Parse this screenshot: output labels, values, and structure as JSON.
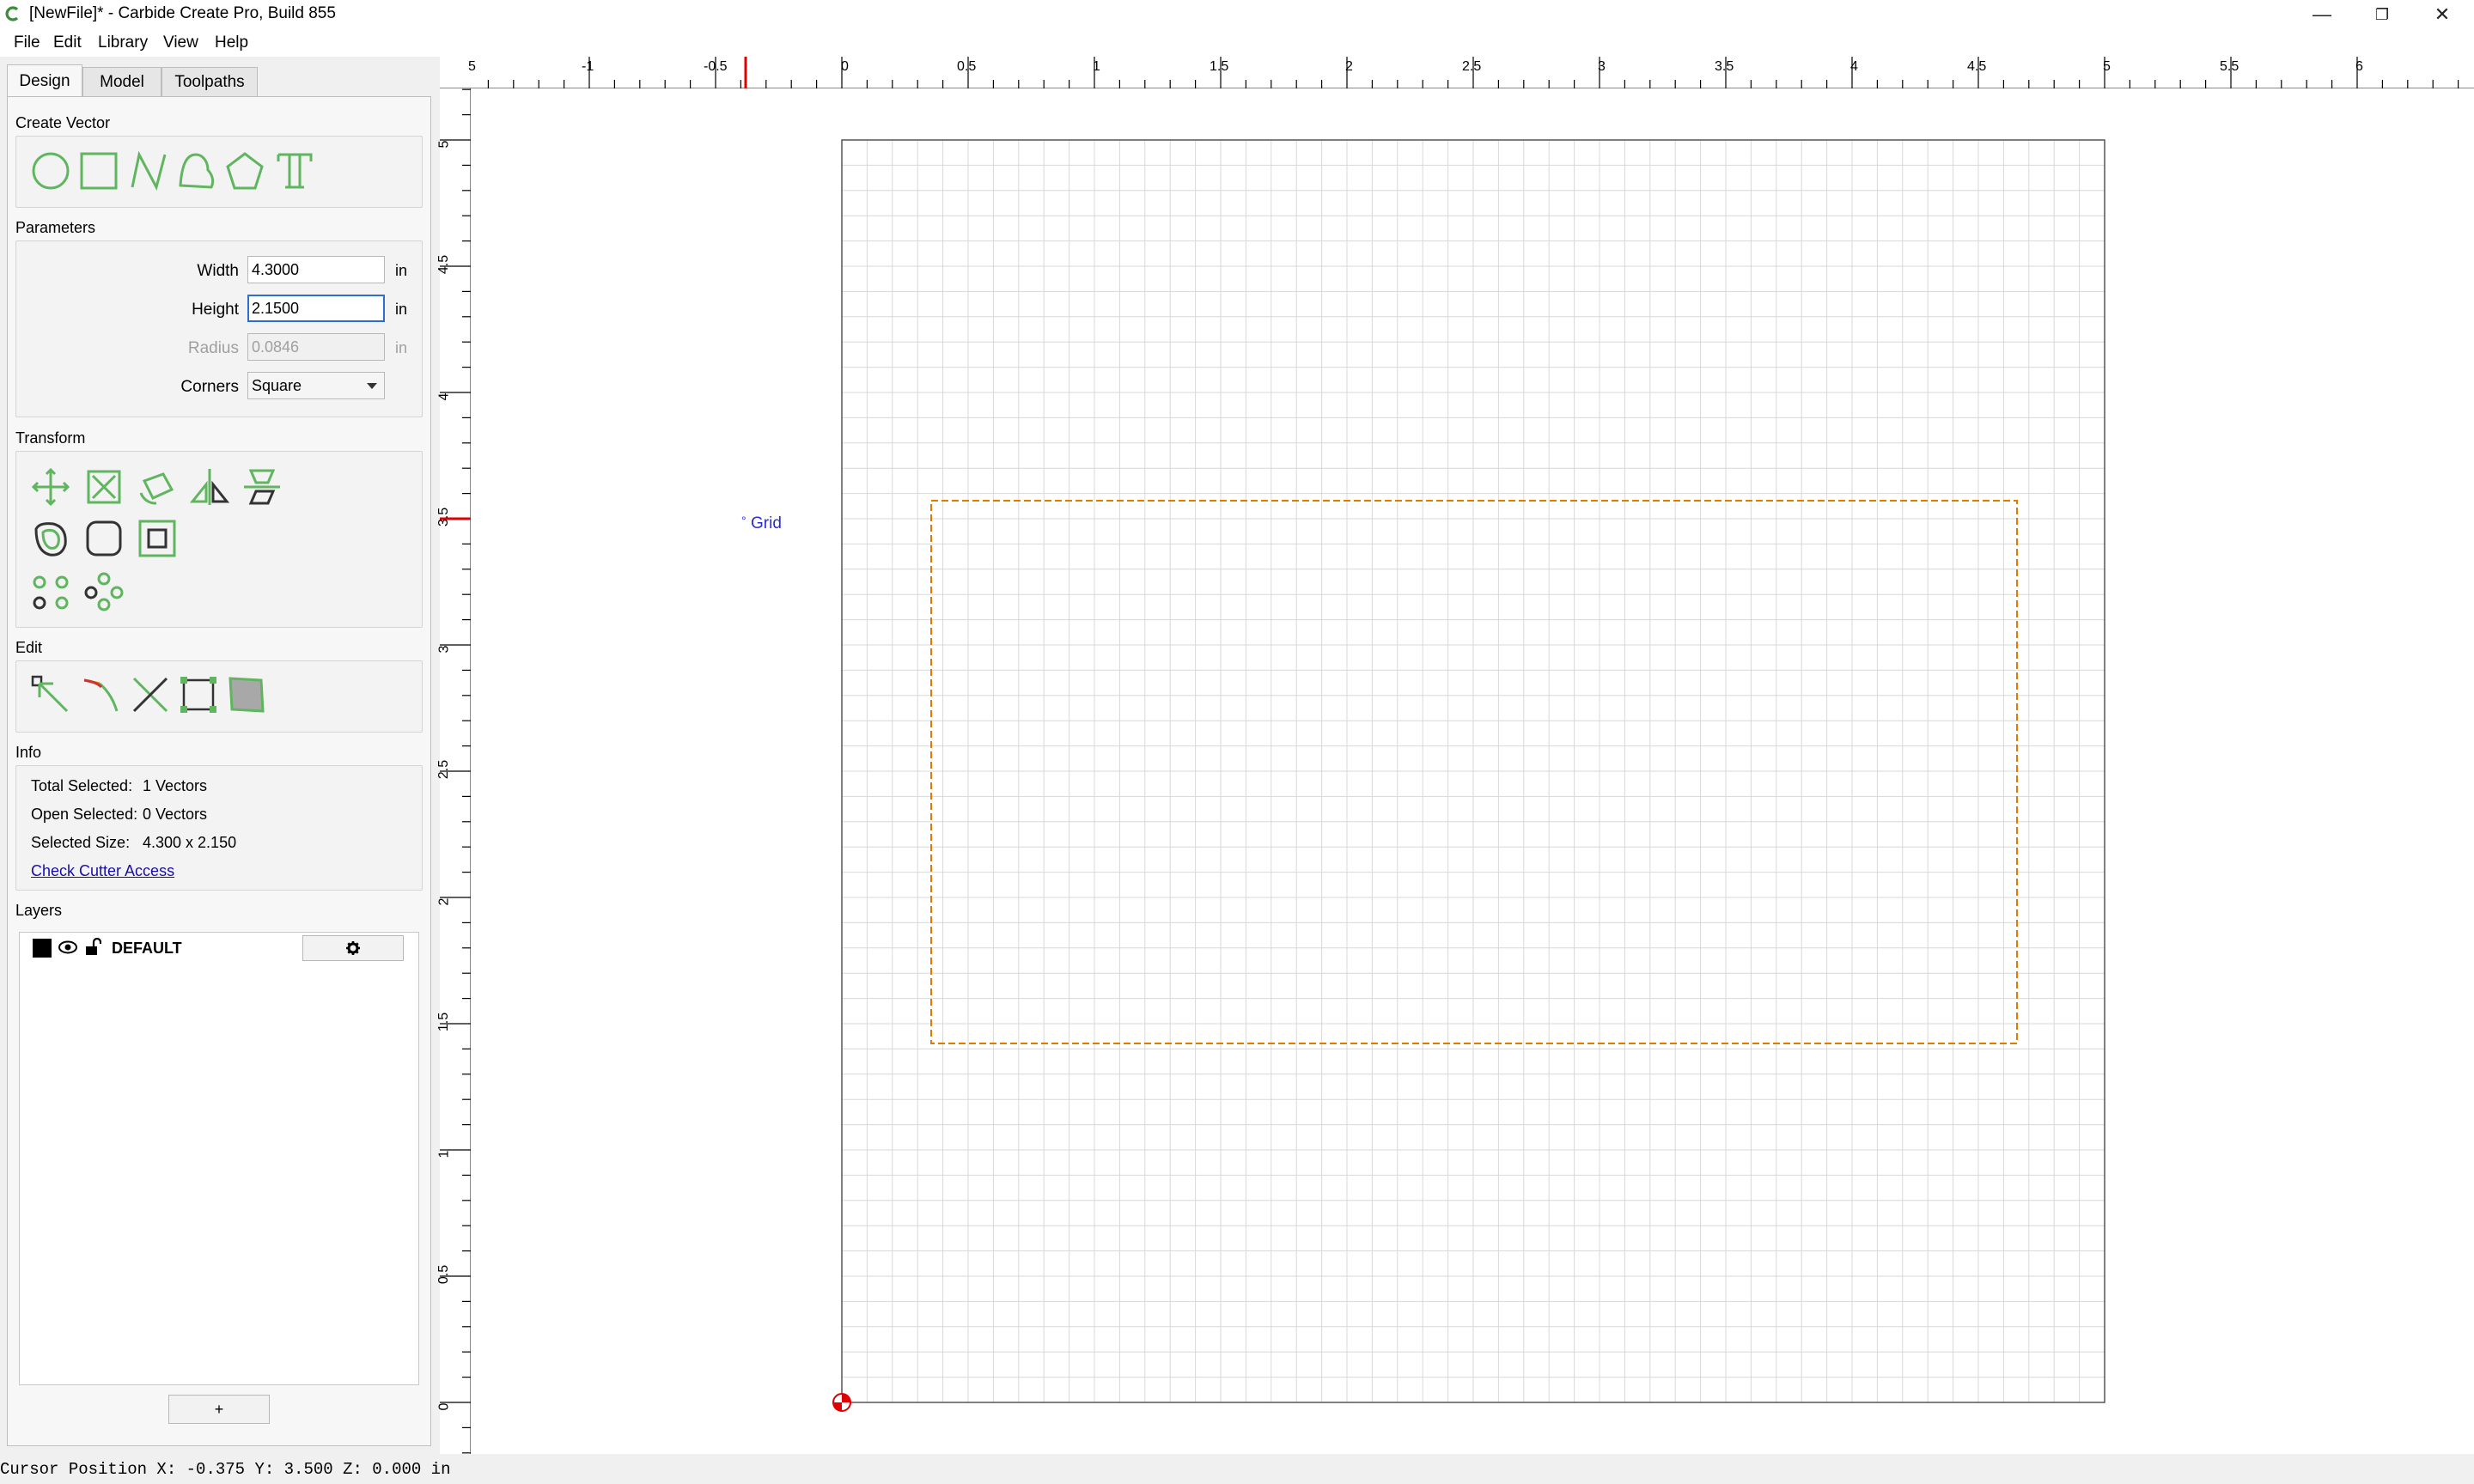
{
  "window": {
    "title": "[NewFile]* - Carbide Create Pro, Build 855",
    "controls": {
      "minimize": "—",
      "maximize": "❐",
      "close": "✕"
    }
  },
  "menu": [
    "File",
    "Edit",
    "Library",
    "View",
    "Help"
  ],
  "tabs": [
    "Design",
    "Model",
    "Toolpaths"
  ],
  "create_vector": {
    "label": "Create Vector",
    "tools": [
      "circle-icon",
      "rectangle-icon",
      "polyline-icon",
      "curve-icon",
      "polygon-icon",
      "text-icon"
    ]
  },
  "parameters": {
    "label": "Parameters",
    "width_label": "Width",
    "width_value": "4.3000",
    "width_unit": "in",
    "height_label": "Height",
    "height_value": "2.1500",
    "height_unit": "in",
    "radius_label": "Radius",
    "radius_value": "0.0846",
    "radius_unit": "in",
    "corners_label": "Corners",
    "corners_value": "Square"
  },
  "transform": {
    "label": "Transform",
    "tools": [
      "move-icon",
      "scale-icon",
      "rotate-icon",
      "mirror-icon",
      "align-icon",
      "offset-icon",
      "fillet-icon",
      "boolean-icon",
      "array-grid-icon",
      "array-circular-icon"
    ]
  },
  "edit": {
    "label": "Edit",
    "tools": [
      "node-edit-icon",
      "join-icon",
      "trim-icon",
      "bounding-box-icon",
      "fill-icon"
    ]
  },
  "info": {
    "label": "Info",
    "total_selected_label": "Total Selected:",
    "total_selected_value": "1 Vectors",
    "open_selected_label": "Open Selected:",
    "open_selected_value": "0 Vectors",
    "selected_size_label": "Selected Size:",
    "selected_size_value": "4.300 x 2.150",
    "check_cutter_link": "Check Cutter Access"
  },
  "layers": {
    "label": "Layers",
    "items": [
      {
        "name": "DEFAULT",
        "color": "#000000"
      }
    ],
    "add_button": "+"
  },
  "canvas": {
    "grid_label": "Grid",
    "h_ruler_labels": [
      "-1",
      "-0.5",
      "0",
      "0.5",
      "1",
      "1.5",
      "2",
      "2.5",
      "3",
      "3.5",
      "4",
      "4.5",
      "5",
      "5.5",
      "6"
    ],
    "v_ruler_labels": [
      "5",
      "4.5",
      "4",
      "3.5",
      "3",
      "2.5",
      "2",
      "1.5",
      "1",
      "0.5",
      "0"
    ],
    "selection_color": "#e07b00",
    "cursor_marker_color": "#e00000"
  },
  "status": {
    "cursor_position": "Cursor Position X: -0.375 Y: 3.500 Z: 0.000 in"
  }
}
